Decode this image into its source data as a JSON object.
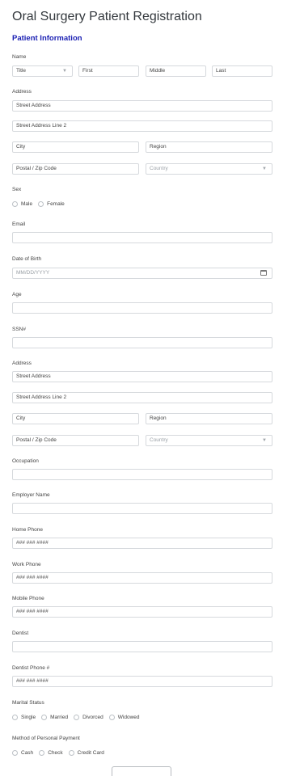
{
  "form": {
    "title": "Oral Surgery Patient Registration",
    "section": "Patient Information"
  },
  "name": {
    "label": "Name",
    "title_select": "Title",
    "first": "First",
    "middle": "Middle",
    "last": "Last"
  },
  "address1": {
    "label": "Address",
    "street": "Street Address",
    "street2": "Street Address Line 2",
    "city": "City",
    "region": "Region",
    "postal": "Postal / Zip Code",
    "country": "Country"
  },
  "sex": {
    "label": "Sex",
    "options": [
      "Male",
      "Female"
    ]
  },
  "email": {
    "label": "Email"
  },
  "dob": {
    "label": "Date of Birth",
    "placeholder": "MM/DD/YYYY"
  },
  "age": {
    "label": "Age"
  },
  "ssn": {
    "label": "SSN#"
  },
  "address2": {
    "label": "Address",
    "street": "Street Address",
    "street2": "Street Address Line 2",
    "city": "City",
    "region": "Region",
    "postal": "Postal / Zip Code",
    "country": "Country"
  },
  "occupation": {
    "label": "Occupation"
  },
  "employer": {
    "label": "Employer Name"
  },
  "home_phone": {
    "label": "Home Phone",
    "placeholder": "### ### ####"
  },
  "work_phone": {
    "label": "Work Phone",
    "placeholder": "### ### ####"
  },
  "mobile_phone": {
    "label": "Mobile Phone",
    "placeholder": "### ### ####"
  },
  "dentist": {
    "label": "Dentist"
  },
  "dentist_phone": {
    "label": "Dentist Phone #",
    "placeholder": "### ### ####"
  },
  "marital": {
    "label": "Marital Status",
    "options": [
      "Single",
      "Married",
      "Divorced",
      "Widowed"
    ]
  },
  "payment": {
    "label": "Method of Personal Payment",
    "options": [
      "Cash",
      "Check",
      "Credit Card"
    ]
  },
  "colors": {
    "section_heading": "#1a1fb3",
    "border": "#d6d9dd",
    "title": "#33383d"
  },
  "icons": {
    "select_caret": "chevron-down-icon",
    "calendar": "calendar-icon",
    "radio": "radio-circle-icon"
  }
}
